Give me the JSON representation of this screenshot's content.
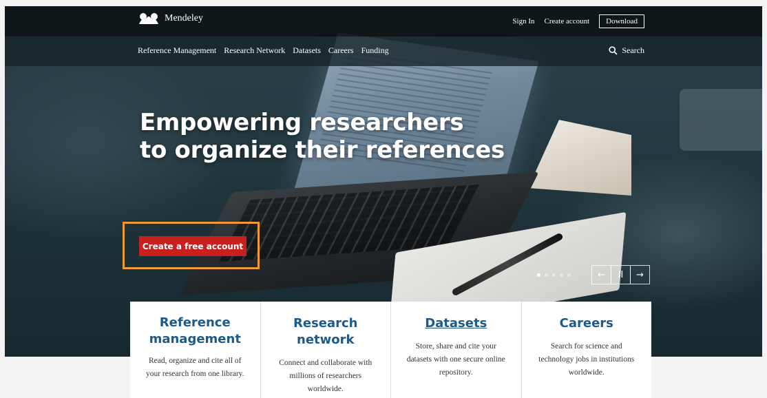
{
  "brand": {
    "name": "Mendeley"
  },
  "header": {
    "sign_in": "Sign In",
    "create_account": "Create account",
    "download": "Download"
  },
  "nav": {
    "items": [
      "Reference Management",
      "Research Network",
      "Datasets",
      "Careers",
      "Funding"
    ],
    "search": "Search"
  },
  "hero": {
    "headline_line1": "Empowering researchers",
    "headline_line2": "to organize their references",
    "cta": "Create a free account",
    "slide_count": 5,
    "active_slide": 1,
    "prev_glyph": "←",
    "pause_glyph": "II",
    "next_glyph": "→"
  },
  "features": [
    {
      "title": "Reference management",
      "text": "Read, organize and cite all of your research from one library."
    },
    {
      "title": "Research network",
      "text": "Connect and collaborate with millions of researchers worldwide."
    },
    {
      "title": "Datasets",
      "text": "Store, share and cite your datasets with one secure online repository."
    },
    {
      "title": "Careers",
      "text": "Search for science and technology jobs in institutions worldwide."
    }
  ],
  "colors": {
    "cta": "#c8201f",
    "highlight": "#f29a33",
    "feature_title": "#1d5a88"
  }
}
